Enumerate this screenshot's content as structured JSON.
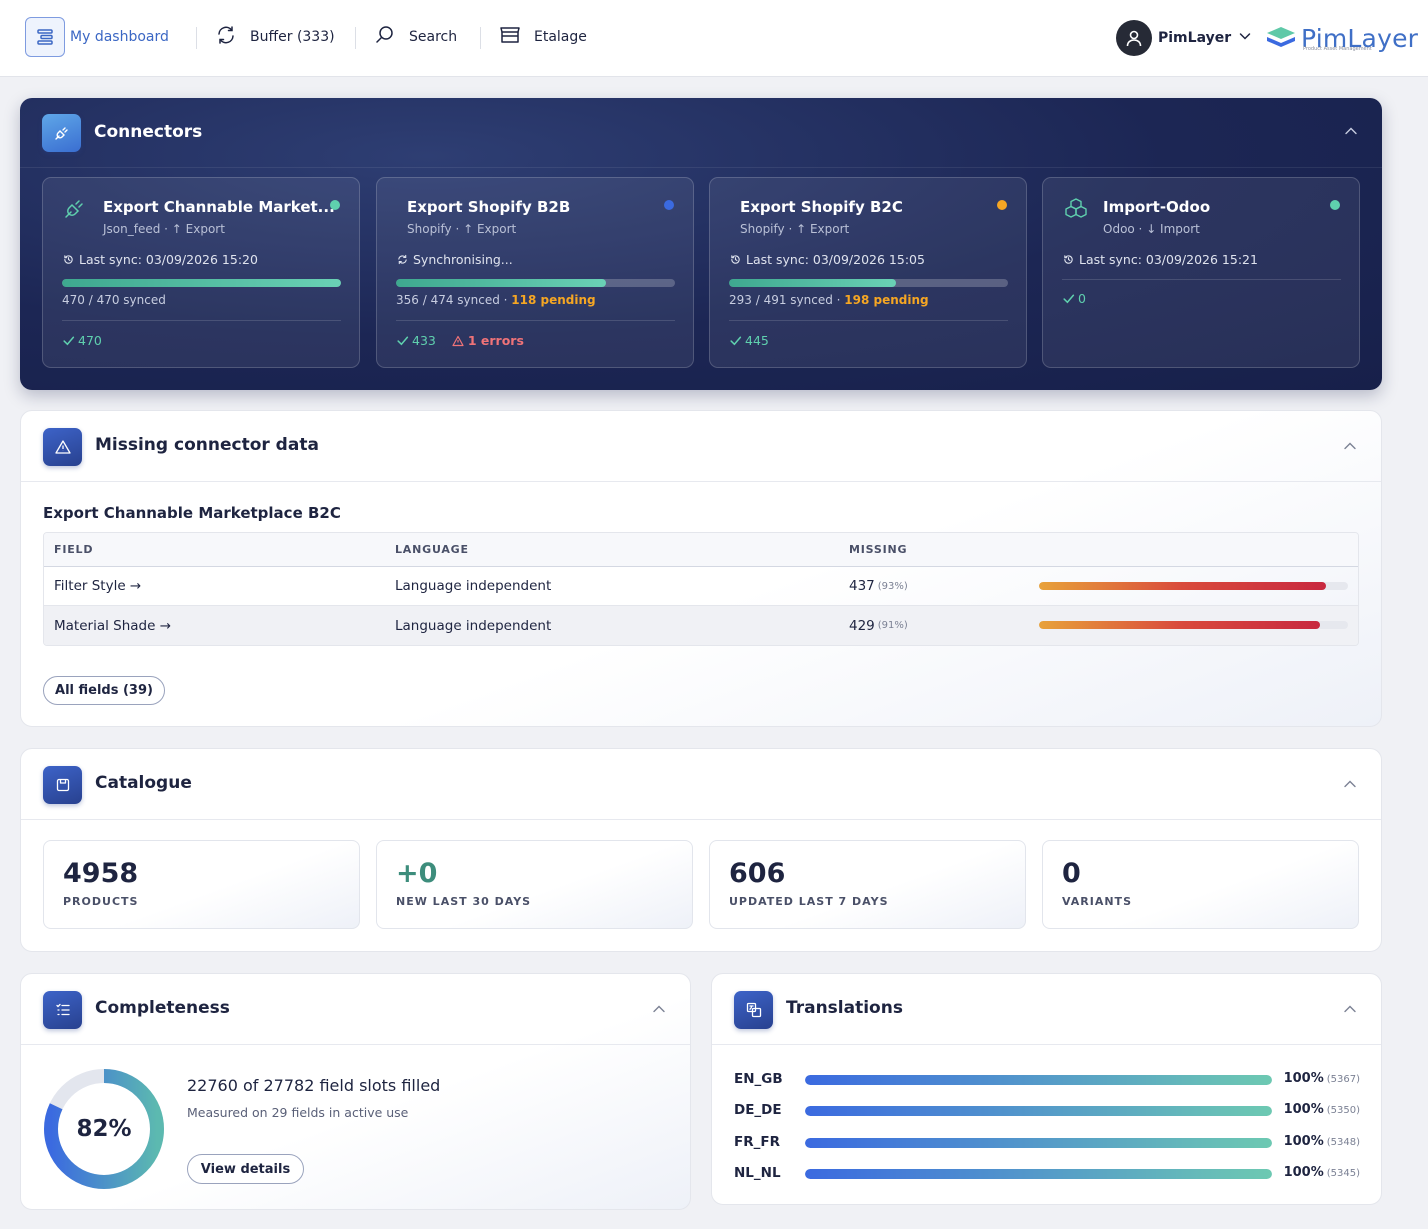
{
  "nav": {
    "dashboard_label": "My dashboard",
    "buffer_label": "Buffer (333)",
    "search_label": "Search",
    "etalage_label": "Etalage",
    "user_name": "PimLayer",
    "logo_text": "PimLayer",
    "logo_tagline": "Product Asset Management"
  },
  "connectors": {
    "title": "Connectors",
    "cards": [
      {
        "title": "Export Channable Market...",
        "sub": "Json_feed · ↑ Export",
        "status_color": "#5fd0ae",
        "sync_text": "Last sync: 03/09/2026 15:20",
        "progress": 1.0,
        "synced_text": "470 / 470 synced",
        "pending_text": "",
        "ok_count": "470",
        "error_text": ""
      },
      {
        "title": "Export Shopify B2B",
        "sub": "Shopify · ↑ Export",
        "status_color": "#3b6ae0",
        "sync_text": "Synchronising...",
        "progress": 0.751,
        "synced_text": "356 / 474 synced · ",
        "pending_text": "118 pending",
        "ok_count": "433",
        "error_text": "1 errors"
      },
      {
        "title": "Export Shopify B2C",
        "sub": "Shopify · ↑ Export",
        "status_color": "#f5a623",
        "sync_text": "Last sync: 03/09/2026 15:05",
        "progress": 0.597,
        "synced_text": "293 / 491 synced · ",
        "pending_text": "198 pending",
        "ok_count": "445",
        "error_text": ""
      },
      {
        "title": "Import-Odoo",
        "sub": "Odoo · ↓ Import",
        "status_color": "#5fd0ae",
        "sync_text": "Last sync: 03/09/2026 15:21",
        "ok_count": "0"
      }
    ]
  },
  "missing": {
    "title": "Missing connector data",
    "connector_name": "Export Channable Marketplace B2C",
    "headers": {
      "field": "FIELD",
      "language": "LANGUAGE",
      "missing": "MISSING"
    },
    "rows": [
      {
        "field": "Filter Style →",
        "language": "Language independent",
        "count": "437",
        "pct": "(93%)",
        "fraction": 0.93
      },
      {
        "field": "Material Shade →",
        "language": "Language independent",
        "count": "429",
        "pct": "(91%)",
        "fraction": 0.91
      }
    ],
    "all_fields_label": "All fields (39)"
  },
  "catalogue": {
    "title": "Catalogue",
    "kpis": [
      {
        "value": "4958",
        "label": "PRODUCTS"
      },
      {
        "value": "+0",
        "label": "NEW LAST 30 DAYS"
      },
      {
        "value": "606",
        "label": "UPDATED LAST 7 DAYS"
      },
      {
        "value": "0",
        "label": "VARIANTS"
      }
    ]
  },
  "completeness": {
    "title": "Completeness",
    "percent_label": "82%",
    "fraction": 0.82,
    "main_text": "22760 of 27782 field slots filled",
    "sub_text": "Measured on 29 fields in active use",
    "button_label": "View details"
  },
  "translations": {
    "title": "Translations",
    "rows": [
      {
        "lang": "EN_GB",
        "pct": "100%",
        "count": "(5367)",
        "fraction": 1.0
      },
      {
        "lang": "DE_DE",
        "pct": "100%",
        "count": "(5350)",
        "fraction": 1.0
      },
      {
        "lang": "FR_FR",
        "pct": "100%",
        "count": "(5348)",
        "fraction": 1.0
      },
      {
        "lang": "NL_NL",
        "pct": "100%",
        "count": "(5345)",
        "fraction": 1.0
      }
    ]
  },
  "colors": {
    "accent": "#3b67c4",
    "success": "#5fd0ae",
    "warning": "#f5a623",
    "error": "#f07378"
  }
}
